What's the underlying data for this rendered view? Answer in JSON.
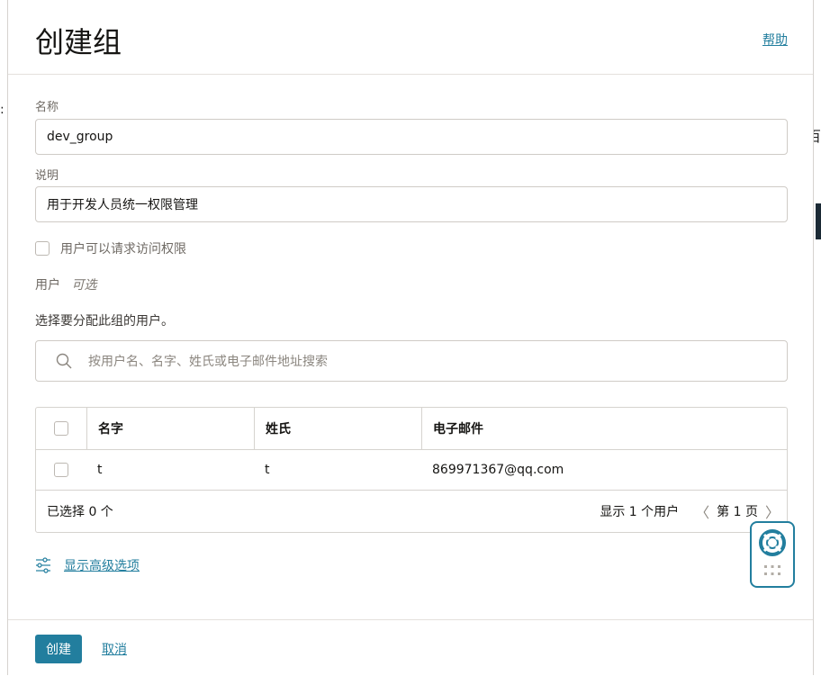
{
  "background": {
    "right_char": "百",
    "left_char": ":"
  },
  "header": {
    "title": "创建组",
    "help_label": "帮助"
  },
  "form": {
    "name_label": "名称",
    "name_value": "dev_group",
    "description_label": "说明",
    "description_value": "用于开发人员统一权限管理",
    "request_access_label": "用户可以请求访问权限",
    "request_access_checked": false,
    "users_label": "用户",
    "users_optional": "可选",
    "assign_text": "选择要分配此组的用户。",
    "search_placeholder": "按用户名、名字、姓氏或电子邮件地址搜索"
  },
  "table": {
    "columns": {
      "first_name": "名字",
      "last_name": "姓氏",
      "email": "电子邮件"
    },
    "rows": [
      {
        "first_name": "t",
        "last_name": "t",
        "email": "869971367@qq.com",
        "checked": false
      }
    ],
    "footer": {
      "selected_count": "已选择 0 个",
      "showing_count": "显示 1 个用户",
      "page_label": "第 1 页",
      "prev_glyph": "〈",
      "next_glyph": "〉"
    }
  },
  "advanced": {
    "label": "显示高级选项"
  },
  "footer": {
    "create_label": "创建",
    "cancel_label": "取消"
  },
  "colors": {
    "accent": "#227e9e",
    "text": "#161513",
    "muted": "#6f6a64",
    "border": "#d6d3cf"
  },
  "icons": {
    "search": "search-icon",
    "advanced": "sliders-icon",
    "help_widget": "lifebuoy-icon",
    "grip": "grip-icon"
  }
}
